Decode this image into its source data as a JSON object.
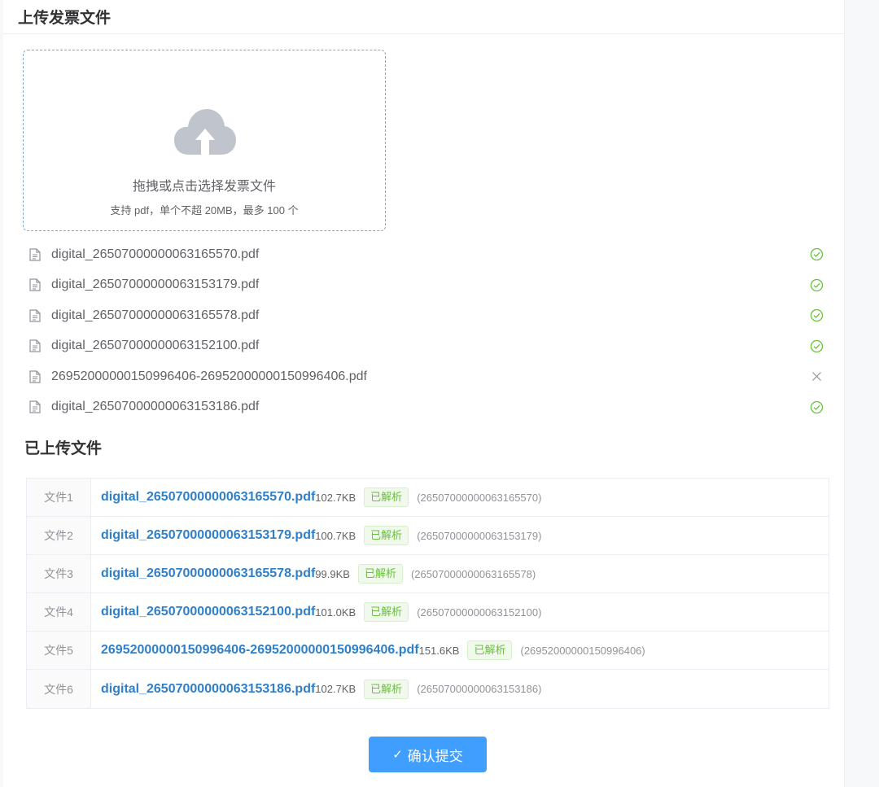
{
  "header": {
    "title": "上传发票文件"
  },
  "dropzone": {
    "main_text": "拖拽或点击选择发票文件",
    "sub_text": "支持 pdf，单个不超 20MB，最多 100 个",
    "icon": "cloud-upload-icon"
  },
  "file_list": [
    {
      "name": "digital_26507000000063165570.pdf",
      "status": "success"
    },
    {
      "name": "digital_26507000000063153179.pdf",
      "status": "success"
    },
    {
      "name": "digital_26507000000063165578.pdf",
      "status": "success"
    },
    {
      "name": "digital_26507000000063152100.pdf",
      "status": "success"
    },
    {
      "name": "26952000000150996406-26952000000150996406.pdf",
      "status": "removable"
    },
    {
      "name": "digital_26507000000063153186.pdf",
      "status": "success"
    }
  ],
  "uploaded": {
    "title": "已上传文件",
    "rows": [
      {
        "label": "文件1",
        "name": "digital_26507000000063165570.pdf",
        "size": "102.7KB",
        "tag": "已解析",
        "code": "(26507000000063165570)"
      },
      {
        "label": "文件2",
        "name": "digital_26507000000063153179.pdf",
        "size": "100.7KB",
        "tag": "已解析",
        "code": "(26507000000063153179)"
      },
      {
        "label": "文件3",
        "name": "digital_26507000000063165578.pdf",
        "size": "99.9KB",
        "tag": "已解析",
        "code": "(26507000000063165578)"
      },
      {
        "label": "文件4",
        "name": "digital_26507000000063152100.pdf",
        "size": "101.0KB",
        "tag": "已解析",
        "code": "(26507000000063152100)"
      },
      {
        "label": "文件5",
        "name": "26952000000150996406-26952000000150996406.pdf",
        "size": "151.6KB",
        "tag": "已解析",
        "code": "(26952000000150996406)"
      },
      {
        "label": "文件6",
        "name": "digital_26507000000063153186.pdf",
        "size": "102.7KB",
        "tag": "已解析",
        "code": "(26507000000063153186)"
      }
    ]
  },
  "actions": {
    "submit_label": "确认提交",
    "submit_icon": "check-icon"
  },
  "colors": {
    "primary": "#409eff",
    "success": "#67c23a",
    "link": "#2f80c9"
  }
}
